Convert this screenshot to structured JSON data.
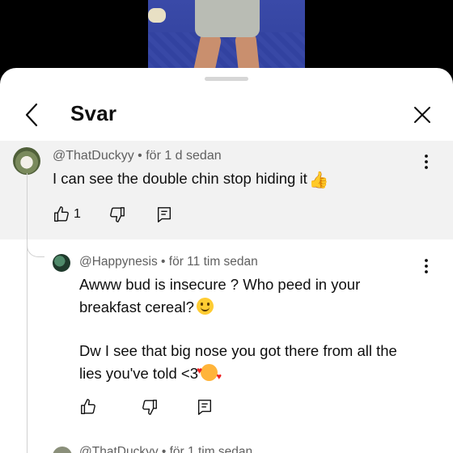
{
  "sheet": {
    "title": "Svar"
  },
  "parent_comment": {
    "author": "@ThatDuckyy",
    "time": "för 1 d sedan",
    "text": "I can see the double chin stop hiding it",
    "emoji": "👍",
    "like_count": "1"
  },
  "reply": {
    "author": "@Happynesis",
    "time": "för 11 tim sedan",
    "line1": "Awww bud is insecure ? Who peed in your",
    "line2": "breakfast cereal?",
    "line3": "Dw I see that big nose you got there from all the",
    "line4": "lies you've told <3"
  },
  "next_reply_peek": {
    "author": "@ThatDuckyy",
    "time": "för 1 tim sedan"
  },
  "icons": {
    "back": "chevron-left-icon",
    "close": "close-icon",
    "more": "more-vert-icon",
    "like": "thumb-up-icon",
    "dislike": "thumb-down-icon",
    "reply": "comment-icon"
  }
}
